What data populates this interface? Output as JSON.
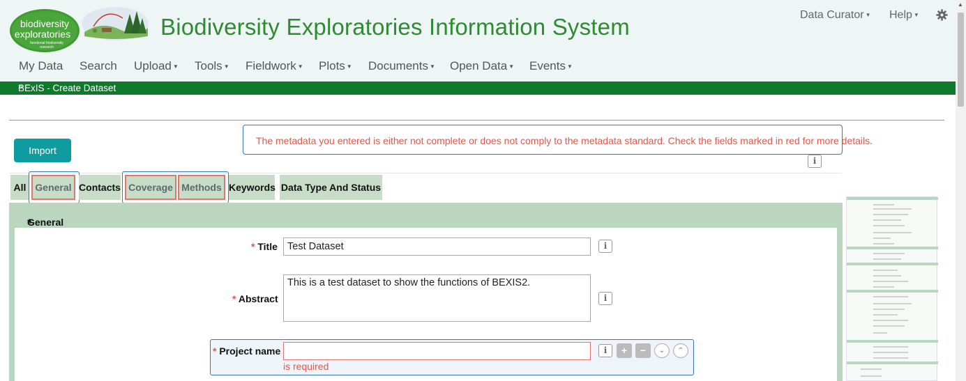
{
  "header": {
    "logo_text_1": "biodiversity",
    "logo_text_2": "exploratories",
    "logo_text_3": "functional biodiversity",
    "logo_text_4": "research",
    "title": "Biodiversity Exploratories Information System",
    "user_menu": "Data Curator",
    "help_menu": "Help"
  },
  "nav": {
    "items": [
      {
        "label": "My Data",
        "dropdown": false
      },
      {
        "label": "Search",
        "dropdown": false
      },
      {
        "label": "Upload",
        "dropdown": true
      },
      {
        "label": "Tools",
        "dropdown": true
      },
      {
        "label": "Fieldwork",
        "dropdown": true
      },
      {
        "label": "Plots",
        "dropdown": true
      },
      {
        "label": "Documents",
        "dropdown": true
      },
      {
        "label": "Open Data",
        "dropdown": true
      },
      {
        "label": "Events",
        "dropdown": true
      }
    ]
  },
  "breadcrumb_bar": "BExIS - Create Dataset",
  "import_button": "Import",
  "alert": "The metadata you entered is either not complete or does not comply to the metadata standard. Check the fields marked in red for more details.",
  "tabs": [
    {
      "label": "All",
      "error": false
    },
    {
      "label": "General",
      "error": true
    },
    {
      "label": "Contacts",
      "error": false
    },
    {
      "label": "Coverage",
      "error": true
    },
    {
      "label": "Methods",
      "error": true
    },
    {
      "label": "Keywords",
      "error": false
    },
    {
      "label": "Data Type And Status",
      "error": false
    }
  ],
  "section": {
    "title": "General",
    "required_mark": "*"
  },
  "fields": {
    "title": {
      "label": "Title",
      "value": "Test Dataset"
    },
    "abstract": {
      "label": "Abstract",
      "value": "This is a test dataset to show the functions of BEXIS2."
    },
    "project_name": {
      "label": "Project name",
      "value": "",
      "error": "is required"
    }
  },
  "colors": {
    "brand_green": "#2e8b34",
    "bar_green": "#0f7a2c",
    "teal": "#0e9ca0",
    "error_red": "#e0584b",
    "focus_blue": "#3a77b5",
    "section_green": "#bad6be"
  },
  "icons": [
    "settings-gear-icon",
    "info-icon",
    "plus-icon",
    "minus-icon",
    "chevron-down-icon",
    "chevron-up-icon",
    "double-chevron-down-icon"
  ]
}
